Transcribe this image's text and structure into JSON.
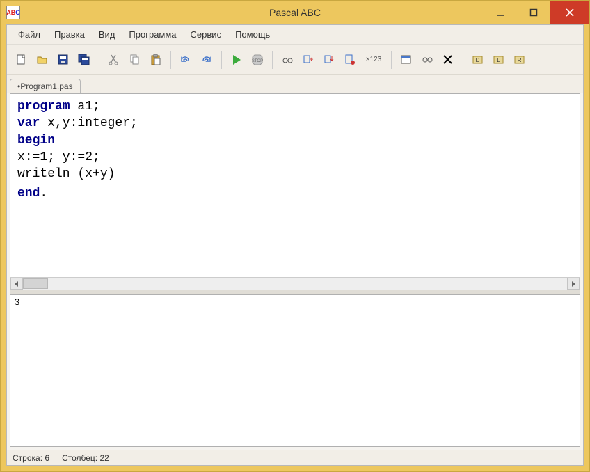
{
  "window": {
    "title": "Pascal ABC"
  },
  "menu": {
    "items": [
      "Файл",
      "Правка",
      "Вид",
      "Программа",
      "Сервис",
      "Помощь"
    ]
  },
  "toolbar": {
    "icons": [
      {
        "name": "new-file-icon",
        "group": 1
      },
      {
        "name": "open-file-icon",
        "group": 1
      },
      {
        "name": "save-icon",
        "group": 1
      },
      {
        "name": "save-all-icon",
        "group": 1
      },
      {
        "name": "cut-icon",
        "group": 2
      },
      {
        "name": "copy-icon",
        "group": 2
      },
      {
        "name": "paste-icon",
        "group": 2
      },
      {
        "name": "undo-icon",
        "group": 3
      },
      {
        "name": "redo-icon",
        "group": 3
      },
      {
        "name": "run-icon",
        "group": 4
      },
      {
        "name": "stop-icon",
        "group": 4
      },
      {
        "name": "glasses-icon",
        "group": 5
      },
      {
        "name": "step-over-icon",
        "group": 5
      },
      {
        "name": "step-into-icon",
        "group": 5
      },
      {
        "name": "breakpoint-icon",
        "group": 5
      },
      {
        "name": "x123-icon",
        "group": 5
      },
      {
        "name": "window-icon",
        "group": 6
      },
      {
        "name": "goggles-icon",
        "group": 6
      },
      {
        "name": "close-icon",
        "group": 6
      },
      {
        "name": "module1-icon",
        "group": 7
      },
      {
        "name": "module2-icon",
        "group": 7
      },
      {
        "name": "module3-icon",
        "group": 7
      }
    ]
  },
  "tabs": [
    {
      "label": "•Program1.pas",
      "modified": true
    }
  ],
  "code": {
    "line1_kw": "program",
    "line1_rest": " a1;",
    "line2_kw": "var",
    "line2_rest": " x,y:integer;",
    "line3_kw": "begin",
    "line4": "x:=1; y:=2;",
    "line5": "writeln (x+y)",
    "line6_kw": "end",
    "line6_rest": "."
  },
  "output": {
    "text": "3"
  },
  "status": {
    "line_label": "Строка:",
    "line_value": "6",
    "col_label": "Столбец:",
    "col_value": "22"
  }
}
